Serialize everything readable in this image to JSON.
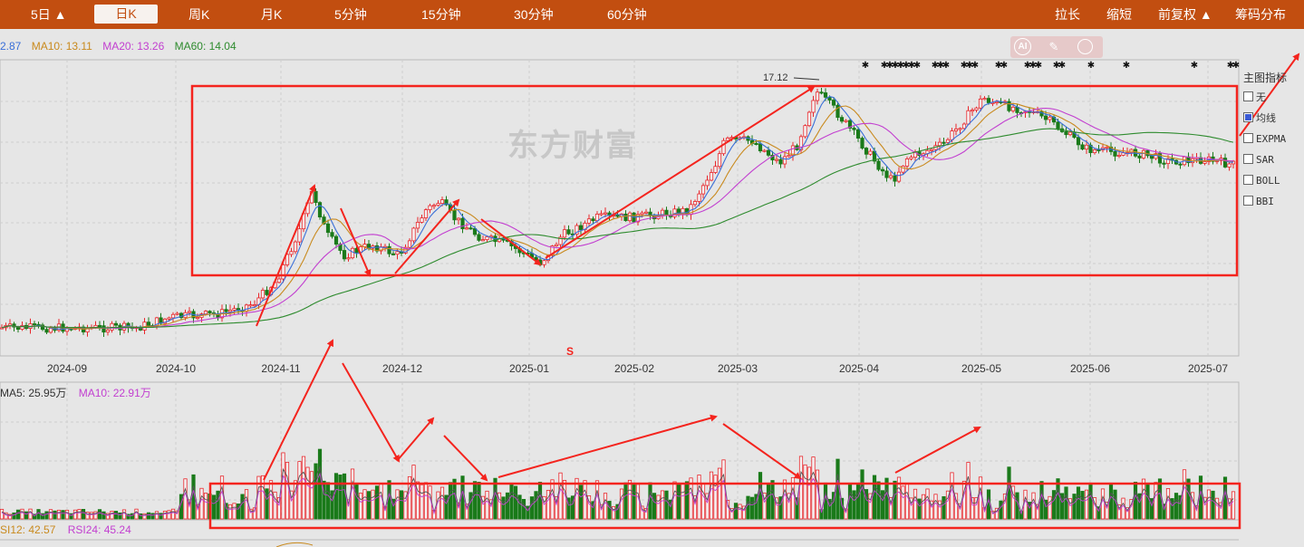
{
  "topbar": {
    "tabs": [
      {
        "label": "5日 ▲",
        "active": false
      },
      {
        "label": "日K",
        "active": true
      },
      {
        "label": "周K",
        "active": false
      },
      {
        "label": "月K",
        "active": false
      },
      {
        "label": "5分钟",
        "active": false
      },
      {
        "label": "15分钟",
        "active": false
      },
      {
        "label": "30分钟",
        "active": false
      },
      {
        "label": "60分钟",
        "active": false
      }
    ],
    "right_tabs": [
      {
        "label": "拉长"
      },
      {
        "label": "缩短"
      },
      {
        "label": "前复权 ▲"
      },
      {
        "label": "筹码分布"
      }
    ]
  },
  "ma_legend": [
    {
      "text": "2.87",
      "color": "#3a6fd8"
    },
    {
      "text": "MA10: 13.11",
      "color": "#c98a1e"
    },
    {
      "text": "MA20: 13.26",
      "color": "#c23fd0"
    },
    {
      "text": "MA60: 14.04",
      "color": "#2e8b2e"
    }
  ],
  "vol_legend": [
    {
      "text": "MA5: 25.95万",
      "color": "#333333"
    },
    {
      "text": "MA10: 22.91万",
      "color": "#c23fd0"
    }
  ],
  "rsi_legend": [
    {
      "text": "SI12: 42.57",
      "color": "#c98a1e"
    },
    {
      "text": "RSI24: 45.24",
      "color": "#c23fd0"
    }
  ],
  "price_chart": {
    "watermark": "东方财富",
    "peak_label": "17.12",
    "x_ticks": [
      "2024-09",
      "2024-10",
      "2024-11",
      "2024-12",
      "2025-01",
      "2025-02",
      "2025-03",
      "2025-04",
      "2025-05",
      "2025-06",
      "2025-07"
    ],
    "dividend_marker": "S",
    "colors": {
      "up": "#e8262b",
      "down": "#1a7a1a",
      "ma5": "#3a6fd8",
      "ma10": "#c98a1e",
      "ma20": "#c23fd0",
      "ma60": "#2e8b2e",
      "annotation": "#f4241e"
    }
  },
  "main_indicators": {
    "title": "主图指标",
    "options": [
      {
        "label": "无",
        "checked": false
      },
      {
        "label": "均线",
        "checked": true
      },
      {
        "label": "EXPMA",
        "checked": false
      },
      {
        "label": "SAR",
        "checked": false
      },
      {
        "label": "BOLL",
        "checked": false
      },
      {
        "label": "BBI",
        "checked": false
      }
    ]
  },
  "toolbar_icons": [
    "ai-icon",
    "draw-pen-icon",
    "magnifier-icon"
  ]
}
